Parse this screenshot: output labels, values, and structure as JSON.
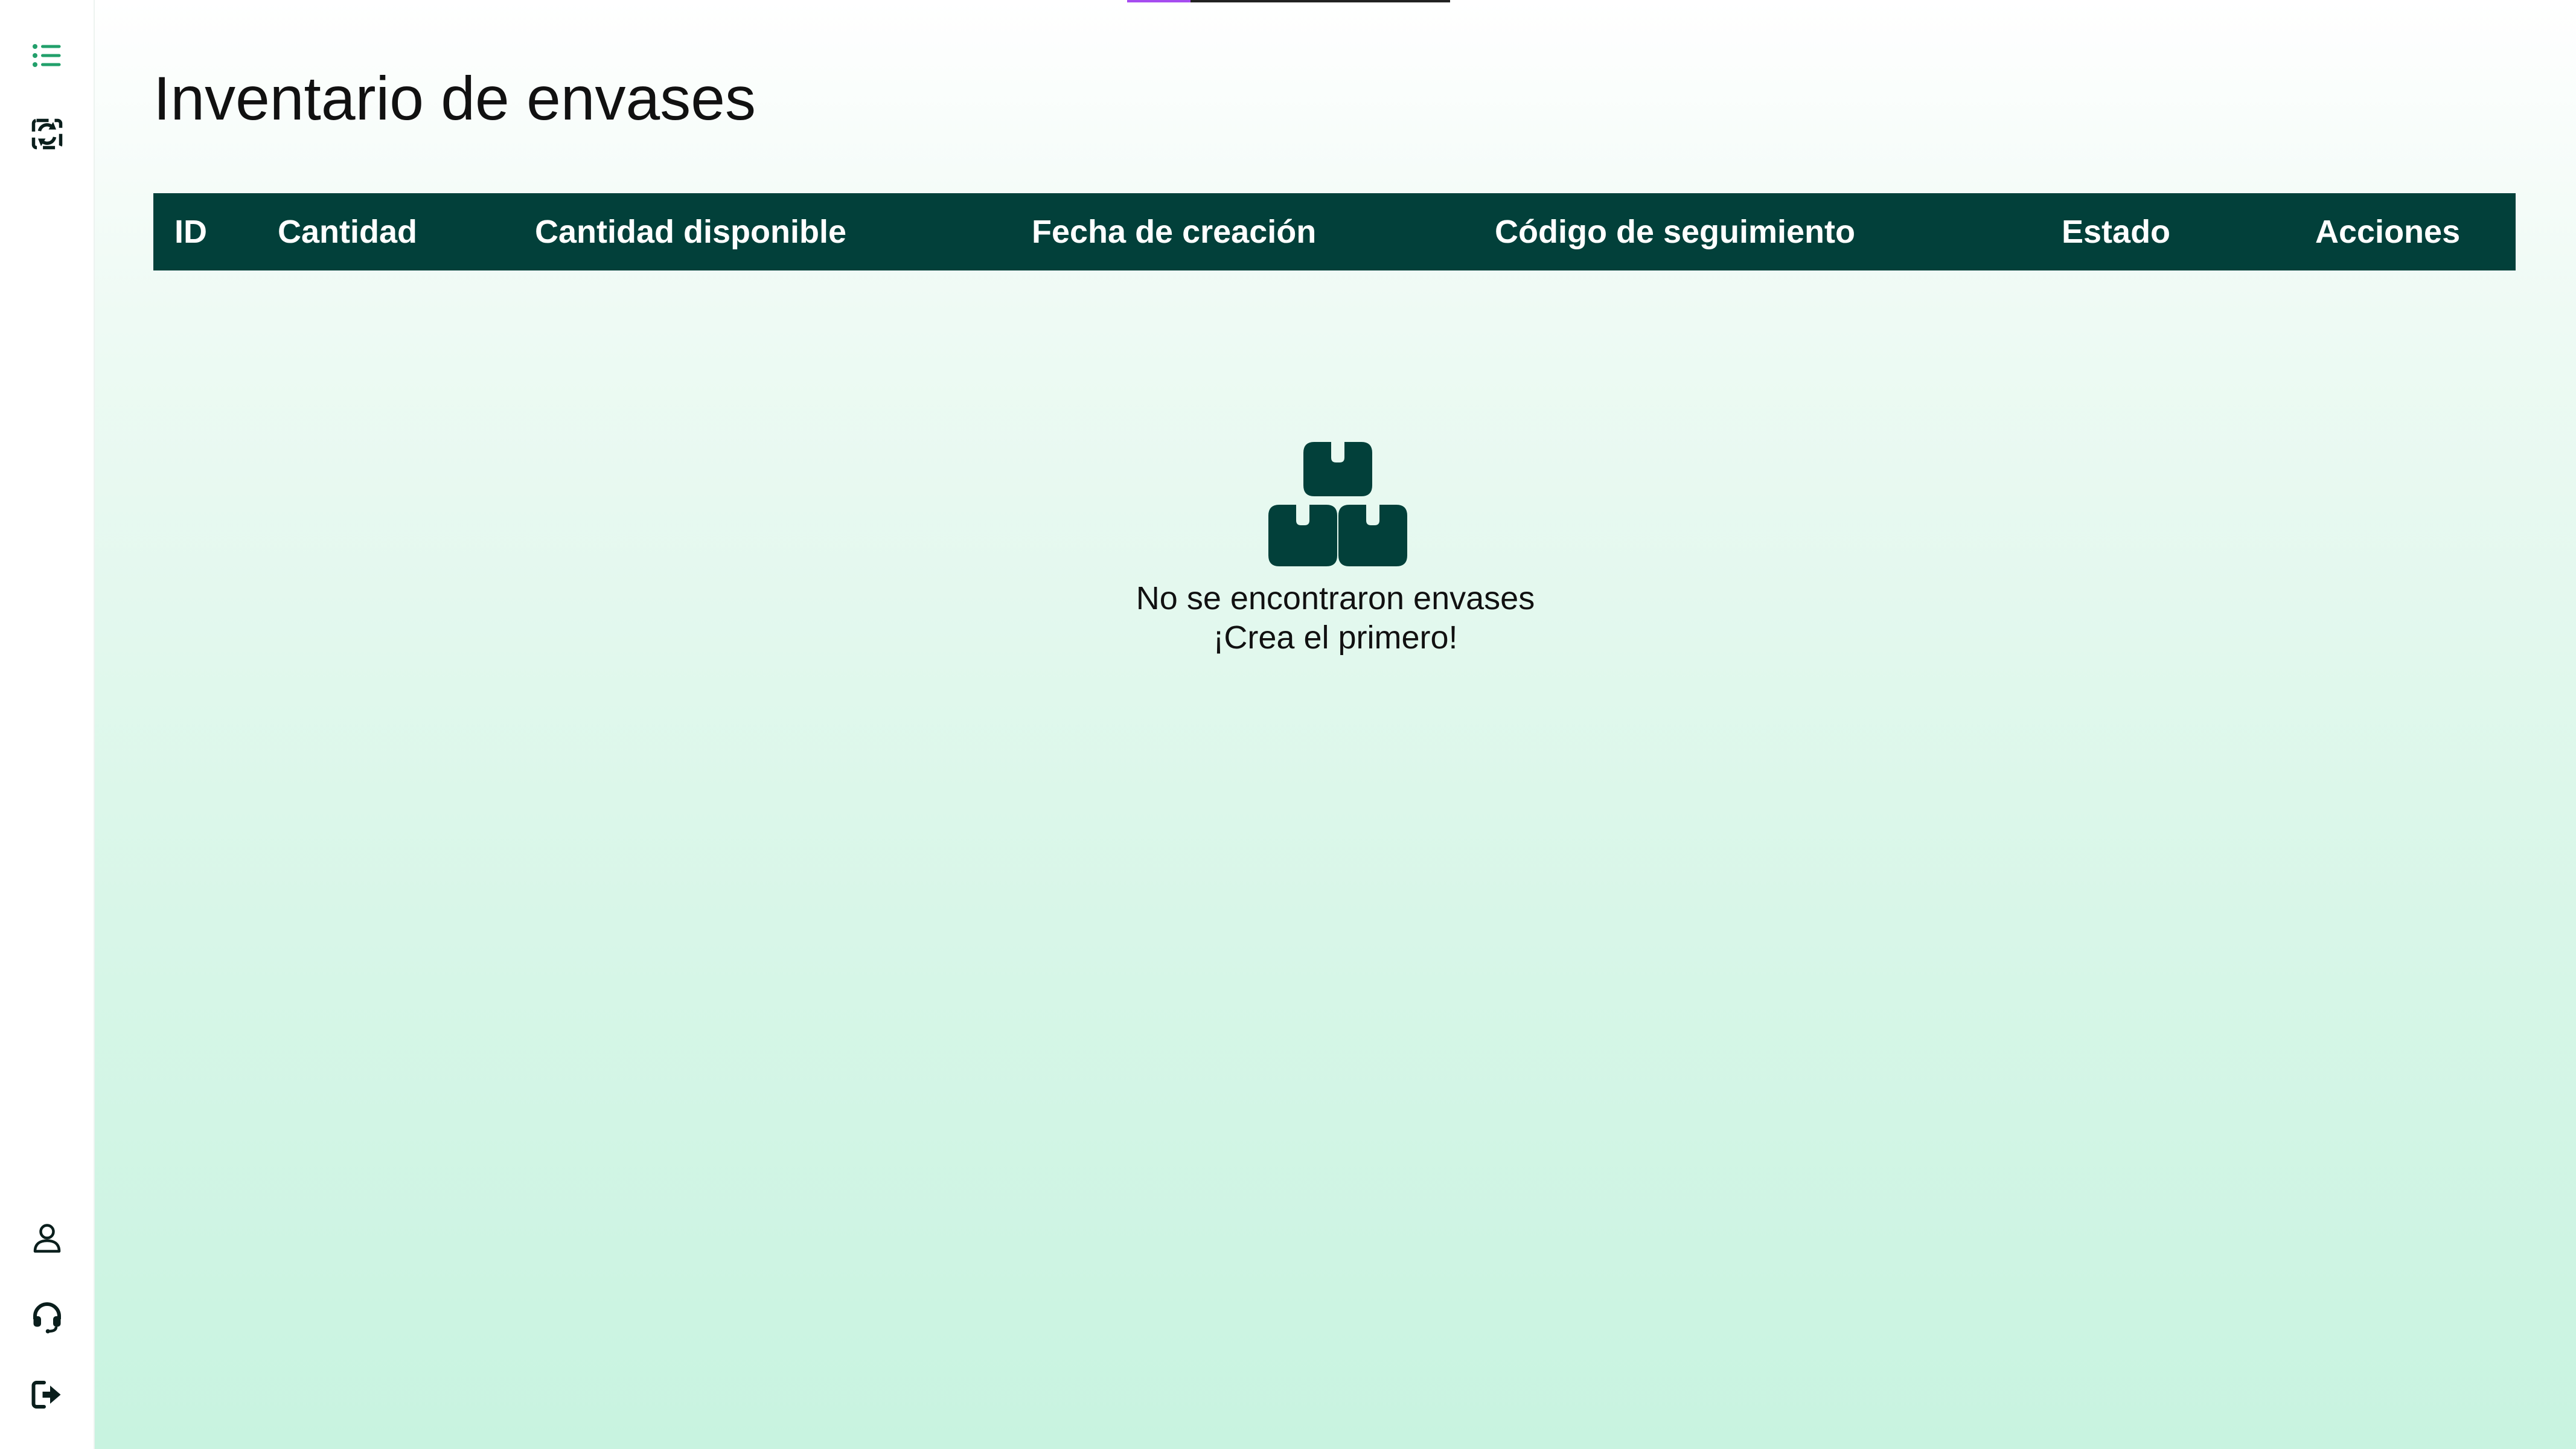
{
  "sidebar": {
    "top_items": [
      {
        "icon": "list-icon",
        "color": "#22a06b"
      },
      {
        "icon": "sync-icon",
        "color": "#0a1e1c"
      }
    ],
    "bottom_items": [
      {
        "icon": "user-icon"
      },
      {
        "icon": "headset-icon"
      },
      {
        "icon": "logout-icon"
      }
    ]
  },
  "page": {
    "title": "Inventario de envases"
  },
  "table": {
    "header_bg": "#02403a",
    "columns": [
      "ID",
      "Cantidad",
      "Cantidad disponible",
      "Fecha de creación",
      "Código de seguimiento",
      "Estado",
      "Acciones"
    ],
    "rows": []
  },
  "empty_state": {
    "icon": "boxes-icon",
    "line1": "No se encontraron envases",
    "line2": "¡Crea el primero!"
  },
  "colors": {
    "accent_green": "#22a06b",
    "dark_teal": "#02403a",
    "accent_purple": "#a64cf0"
  }
}
